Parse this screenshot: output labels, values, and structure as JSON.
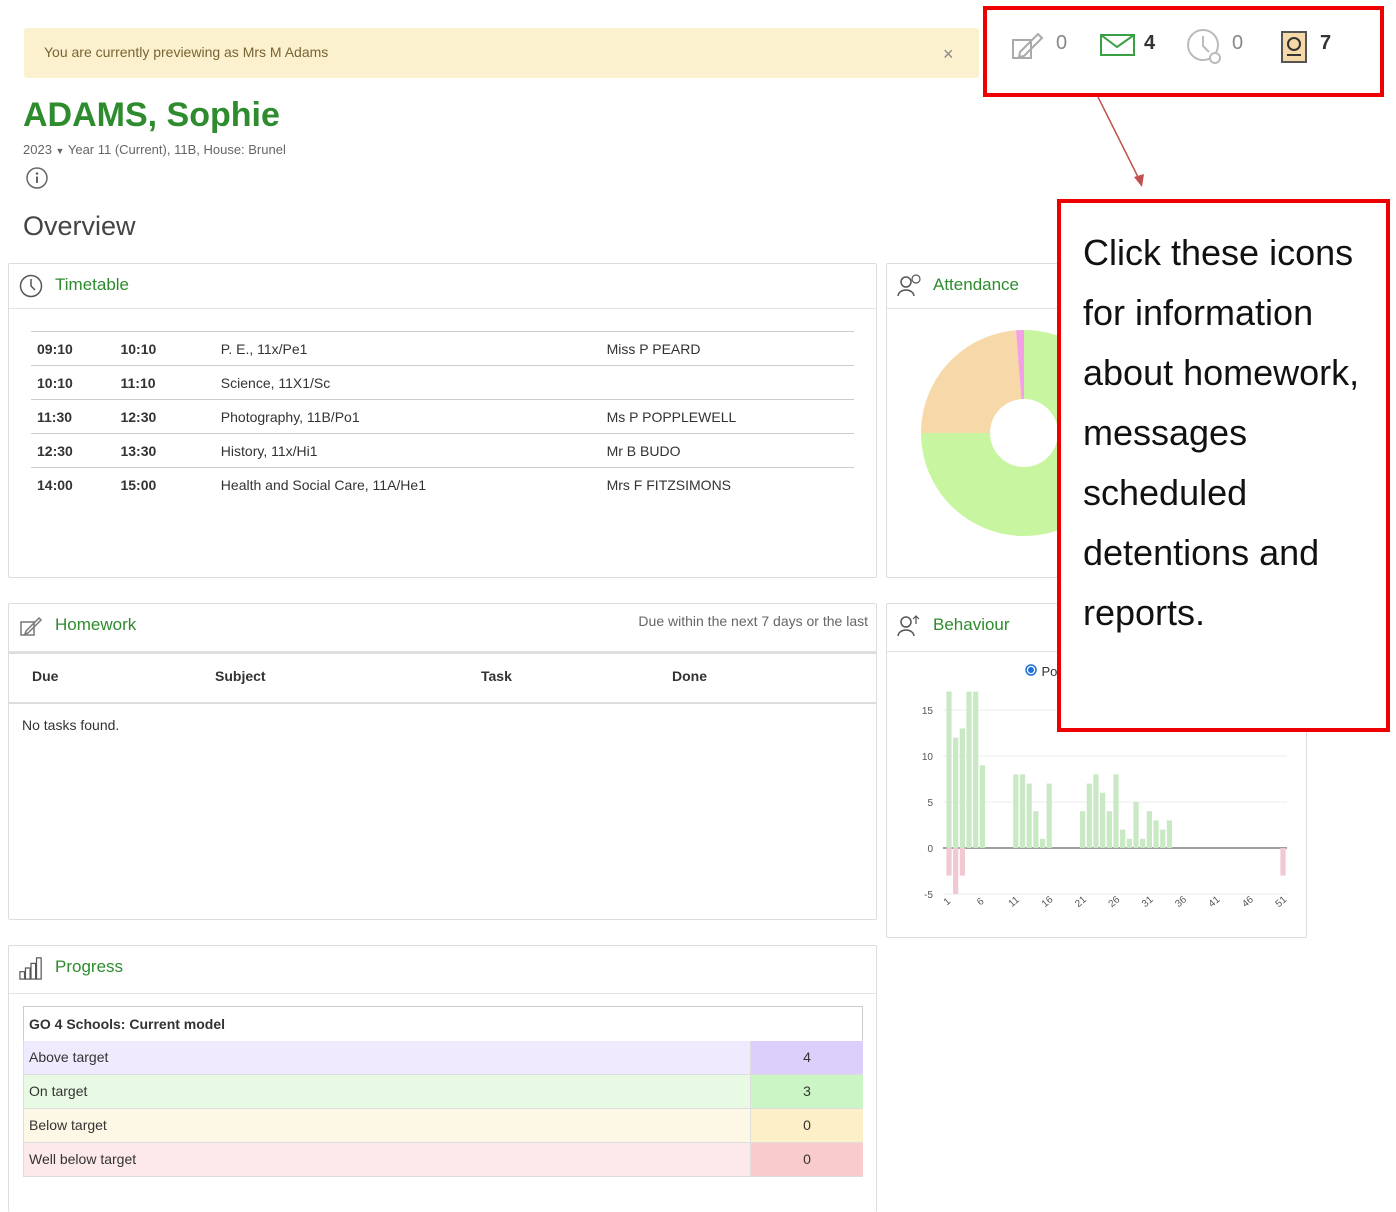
{
  "banner": {
    "text": "You are currently previewing as Mrs M Adams",
    "close": "×"
  },
  "student": {
    "name": "ADAMS, Sophie",
    "year_select": "2023",
    "details": "Year 11 (Current), 11B, House: Brunel"
  },
  "page_title": "Overview",
  "top_counters": [
    {
      "icon": "homework-icon",
      "count": "0"
    },
    {
      "icon": "mail-icon",
      "count": "4"
    },
    {
      "icon": "detention-clock-icon",
      "count": "0"
    },
    {
      "icon": "report-icon",
      "count": "7"
    }
  ],
  "callout": {
    "text": "Click these icons for information about homework, messages scheduled detentions and reports."
  },
  "timetable": {
    "title": "Timetable",
    "rows": [
      {
        "start": "09:10",
        "end": "10:10",
        "lesson": "P. E., 11x/Pe1",
        "teacher": "Miss P PEARD"
      },
      {
        "start": "10:10",
        "end": "11:10",
        "lesson": "Science, 11X1/Sc",
        "teacher": ""
      },
      {
        "start": "11:30",
        "end": "12:30",
        "lesson": "Photography, 11B/Po1",
        "teacher": "Ms P POPPLEWELL"
      },
      {
        "start": "12:30",
        "end": "13:30",
        "lesson": "History, 11x/Hi1",
        "teacher": "Mr B BUDO"
      },
      {
        "start": "14:00",
        "end": "15:00",
        "lesson": "Health and Social Care, 11A/He1",
        "teacher": "Mrs F FITZSIMONS"
      }
    ]
  },
  "attendance": {
    "title": "Attendance",
    "colors": {
      "present": "#c8f5a0",
      "late": "#f7d8a8",
      "other": "#f5a0e6",
      "blue": "#a6d8f0"
    }
  },
  "homework": {
    "title": "Homework",
    "filter": "Due within the next 7 days or the last",
    "columns": [
      "Due",
      "Subject",
      "Task",
      "Done"
    ],
    "empty": "No tasks found."
  },
  "behaviour": {
    "title": "Behaviour",
    "legend_partial": "Po",
    "colors": {
      "positive": "#c9e8c4",
      "negative": "#f0c9d2"
    }
  },
  "chart_data": {
    "type": "bar",
    "title": "",
    "xlabel": "",
    "ylabel": "",
    "ylim": [
      -6,
      17
    ],
    "yticks": [
      15,
      10,
      5,
      0,
      -5
    ],
    "xticks": [
      1,
      6,
      11,
      16,
      21,
      26,
      31,
      36,
      41,
      46,
      51
    ],
    "series": [
      {
        "values": [
          [
            1,
            17
          ],
          [
            2,
            12
          ],
          [
            3,
            13
          ],
          [
            4,
            17
          ],
          [
            5,
            17
          ],
          [
            6,
            9
          ],
          [
            11,
            8
          ],
          [
            12,
            8
          ],
          [
            13,
            7
          ],
          [
            14,
            4
          ],
          [
            15,
            1
          ],
          [
            16,
            7
          ],
          [
            21,
            4
          ],
          [
            22,
            7
          ],
          [
            23,
            8
          ],
          [
            24,
            6
          ],
          [
            25,
            4
          ],
          [
            26,
            8
          ],
          [
            27,
            2
          ],
          [
            28,
            1
          ],
          [
            29,
            5
          ],
          [
            30,
            1
          ],
          [
            31,
            4
          ],
          [
            32,
            3
          ],
          [
            33,
            2
          ],
          [
            34,
            3
          ]
        ]
      },
      {
        "values": [
          [
            1,
            -3
          ],
          [
            2,
            -5
          ],
          [
            3,
            -3
          ],
          [
            51,
            -3
          ]
        ]
      }
    ]
  },
  "progress": {
    "title": "Progress",
    "model": "GO 4 Schools: Current model",
    "rows": [
      {
        "label": "Above target",
        "value": "4",
        "bg": "#efeafd",
        "cell": "#dccffb"
      },
      {
        "label": "On target",
        "value": "3",
        "bg": "#e9fae4",
        "cell": "#cbf5c4"
      },
      {
        "label": "Below target",
        "value": "0",
        "bg": "#fdf8e6",
        "cell": "#fdefc7"
      },
      {
        "label": "Well below target",
        "value": "0",
        "bg": "#fde9ea",
        "cell": "#f9cbcb"
      }
    ]
  }
}
